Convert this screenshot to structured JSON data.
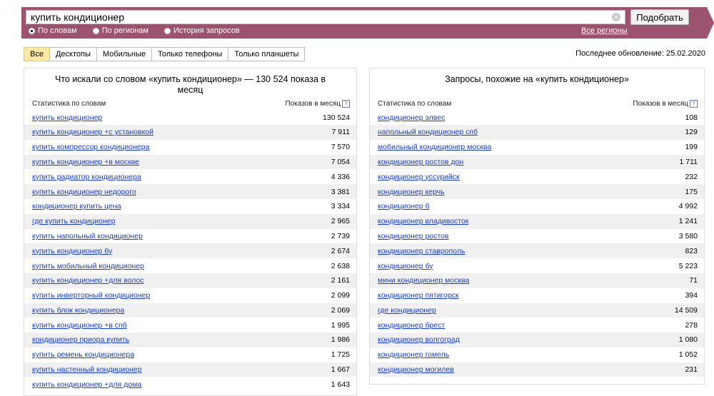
{
  "search": {
    "value": "купить кондиционер",
    "submit_label": "Подобрать",
    "clear_glyph": "×",
    "modes": [
      {
        "label": "По словам",
        "checked": true
      },
      {
        "label": "По регионам",
        "checked": false
      },
      {
        "label": "История запросов",
        "checked": false
      }
    ],
    "regions_link": "Все регионы"
  },
  "tabs": [
    "Все",
    "Десктопы",
    "Мобильные",
    "Только телефоны",
    "Только планшеты"
  ],
  "last_update": "Последнее обновление: 25.02.2020",
  "colors": {
    "brand": "#9c536f",
    "active_tab": "#fbe8a1",
    "link": "#1a3dc1"
  },
  "left_panel": {
    "title": "Что искали со словом «купить кондиционер» — 130 524 показа в месяц",
    "col_phrase": "Статистика по словам",
    "col_count": "Показов в месяц",
    "help_glyph": "?",
    "rows": [
      {
        "q": "купить кондиционер",
        "n": "130 524"
      },
      {
        "q": "купить кондиционер +с установкой",
        "n": "7 911"
      },
      {
        "q": "купить компрессор кондиционера",
        "n": "7 570"
      },
      {
        "q": "купить кондиционер +в москве",
        "n": "7 054"
      },
      {
        "q": "купить радиатор кондиционера",
        "n": "4 336"
      },
      {
        "q": "купить кондиционер недорого",
        "n": "3 381"
      },
      {
        "q": "кондиционер купить цена",
        "n": "3 334"
      },
      {
        "q": "где купить кондиционер",
        "n": "2 965"
      },
      {
        "q": "купить напольный кондиционер",
        "n": "2 739"
      },
      {
        "q": "купить кондиционер бу",
        "n": "2 674"
      },
      {
        "q": "купить мобильный кондиционер",
        "n": "2 638"
      },
      {
        "q": "купить кондиционер +для волос",
        "n": "2 161"
      },
      {
        "q": "купить инверторный кондиционер",
        "n": "2 099"
      },
      {
        "q": "купить блок кондиционера",
        "n": "2 069"
      },
      {
        "q": "купить кондиционер +в спб",
        "n": "1 995"
      },
      {
        "q": "кондиционер приора купить",
        "n": "1 986"
      },
      {
        "q": "купить ремень кондиционера",
        "n": "1 725"
      },
      {
        "q": "купить настенный кондиционер",
        "n": "1 667"
      },
      {
        "q": "купить кондиционер +для дома",
        "n": "1 643"
      }
    ]
  },
  "right_panel": {
    "title": "Запросы, похожие на «купить кондиционер»",
    "col_phrase": "Статистика по словам",
    "col_count": "Показов в месяц",
    "help_glyph": "?",
    "rows": [
      {
        "q": "кондиционер элвес",
        "n": "108"
      },
      {
        "q": "напольный кондиционер спб",
        "n": "129"
      },
      {
        "q": "мобильный кондиционер москва",
        "n": "199"
      },
      {
        "q": "кондиционер ростов дон",
        "n": "1 711"
      },
      {
        "q": "кондиционер уссурийск",
        "n": "232"
      },
      {
        "q": "кондиционер керчь",
        "n": "175"
      },
      {
        "q": "кондиционер б",
        "n": "4 992"
      },
      {
        "q": "кондиционер владивосток",
        "n": "1 241"
      },
      {
        "q": "кондиционер ростов",
        "n": "3 580"
      },
      {
        "q": "кондиционер ставрополь",
        "n": "823"
      },
      {
        "q": "кондиционер бу",
        "n": "5 223"
      },
      {
        "q": "мини кондиционер москва",
        "n": "71"
      },
      {
        "q": "кондиционер пятигорск",
        "n": "394"
      },
      {
        "q": "где кондиционер",
        "n": "14 509"
      },
      {
        "q": "кондиционер брест",
        "n": "278"
      },
      {
        "q": "кондиционер волгоград",
        "n": "1 080"
      },
      {
        "q": "кондиционер гомель",
        "n": "1 052"
      },
      {
        "q": "кондиционер могилев",
        "n": "231"
      }
    ]
  }
}
